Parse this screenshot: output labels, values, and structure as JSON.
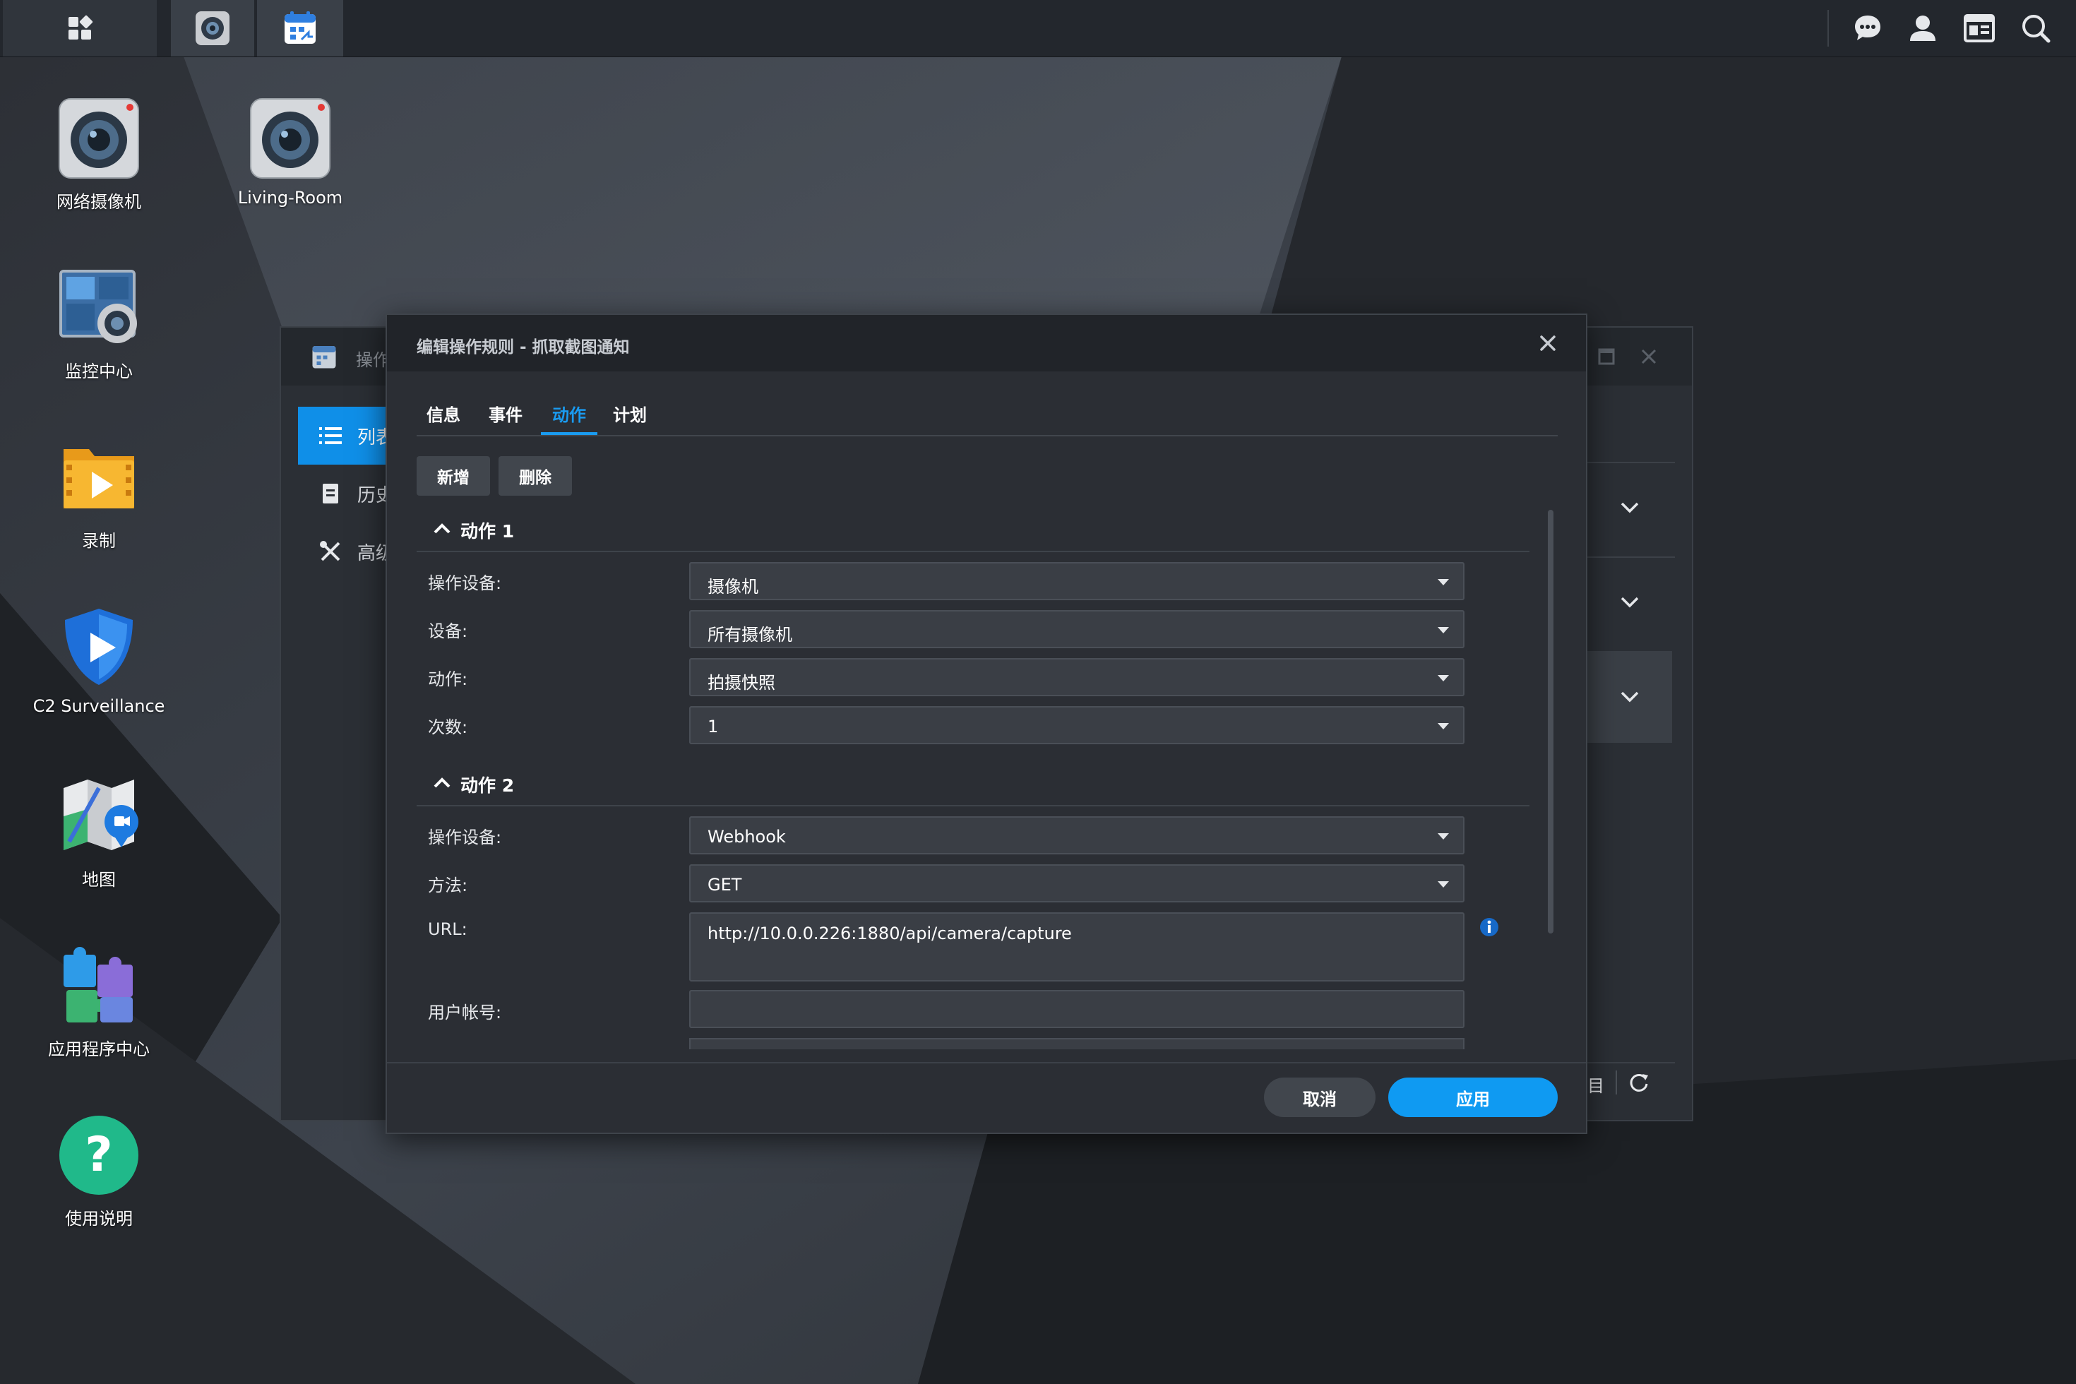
{
  "taskbar": {
    "apps": [
      "surveillance-camera-icon",
      "action-rule-calendar-icon"
    ],
    "right_icons": [
      "chat-icon",
      "user-icon",
      "widgets-icon",
      "search-icon"
    ]
  },
  "desktop": {
    "icons": [
      {
        "label": "网络摄像机",
        "icon": "camera-icon"
      },
      {
        "label": "Living-Room",
        "icon": "camera-icon"
      },
      {
        "label": "监控中心",
        "icon": "monitor-center-icon"
      },
      {
        "label": "录制",
        "icon": "recording-folder-icon"
      },
      {
        "label": "C2 Surveillance",
        "icon": "c2-shield-icon"
      },
      {
        "label": "地图",
        "icon": "map-icon"
      },
      {
        "label": "应用程序中心",
        "icon": "puzzle-icon"
      },
      {
        "label": "使用说明",
        "icon": "help-icon"
      }
    ]
  },
  "background_window": {
    "title": "操作",
    "sidebar": [
      {
        "label": "列表",
        "icon": "list-icon",
        "active": true
      },
      {
        "label": "历史",
        "icon": "history-icon",
        "active": false
      },
      {
        "label": "高级",
        "icon": "tools-icon",
        "active": false
      }
    ],
    "footer_text": "目"
  },
  "dialog": {
    "title": "编辑操作规则 - 抓取截图通知",
    "tabs": [
      {
        "label": "信息",
        "active": false
      },
      {
        "label": "事件",
        "active": false
      },
      {
        "label": "动作",
        "active": true
      },
      {
        "label": "计划",
        "active": false
      }
    ],
    "toolbar": {
      "add_label": "新增",
      "delete_label": "删除"
    },
    "action1": {
      "header": "动作 1",
      "fields": [
        {
          "label": "操作设备:",
          "value": "摄像机"
        },
        {
          "label": "设备:",
          "value": "所有摄像机"
        },
        {
          "label": "动作:",
          "value": "拍摄快照"
        },
        {
          "label": "次数:",
          "value": "1"
        }
      ]
    },
    "action2": {
      "header": "动作 2",
      "fields": [
        {
          "label": "操作设备:",
          "value": "Webhook"
        },
        {
          "label": "方法:",
          "value": "GET"
        },
        {
          "label": "URL:",
          "value": "http://10.0.0.226:1880/api/camera/capture"
        },
        {
          "label": "用户帐号:",
          "value": ""
        }
      ]
    },
    "buttons": {
      "cancel": "取消",
      "apply": "应用"
    },
    "colors": {
      "accent": "#0f9af2",
      "background": "#2b2e34",
      "header": "#212429"
    }
  }
}
